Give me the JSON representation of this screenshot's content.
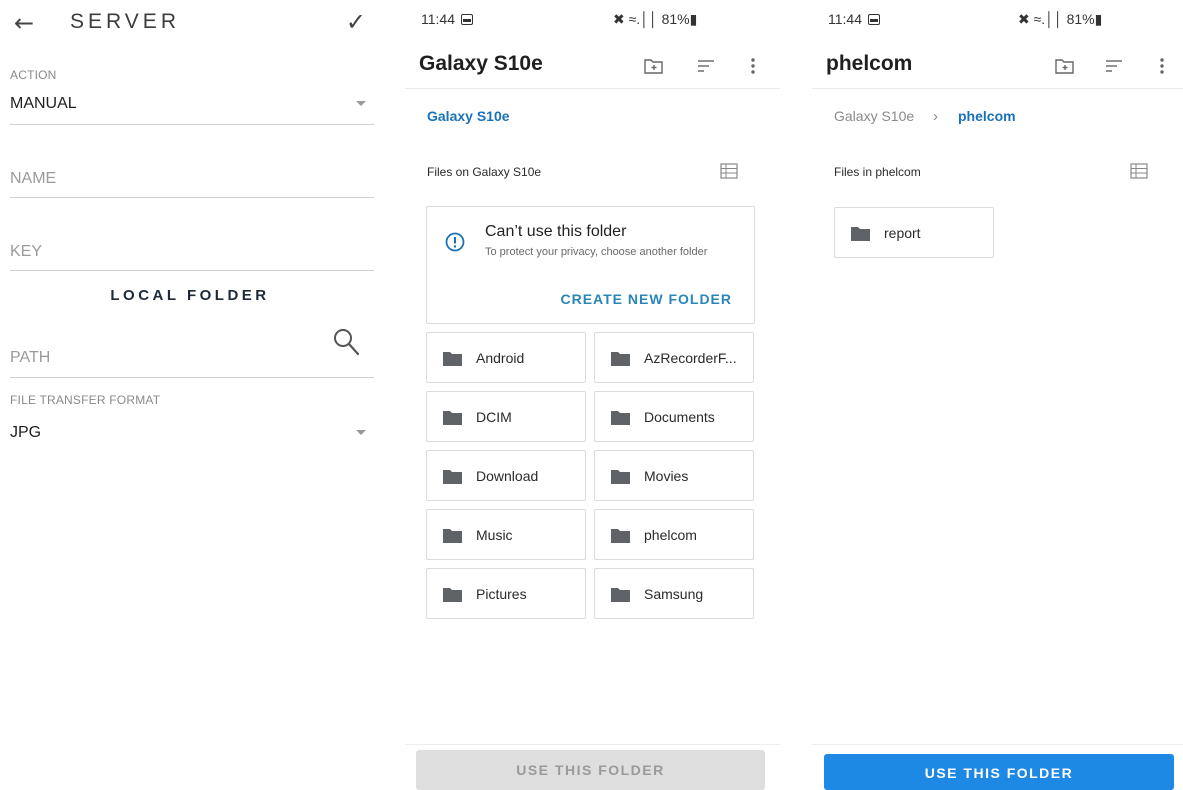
{
  "server_form": {
    "title": "SERVER",
    "back_icon": "arrow-left-icon",
    "confirm_icon": "check-icon",
    "action": {
      "label": "ACTION",
      "value": "MANUAL"
    },
    "name": {
      "placeholder": "NAME"
    },
    "key": {
      "placeholder": "KEY"
    },
    "section_title": "LOCAL FOLDER",
    "path": {
      "placeholder": "PATH",
      "icon": "search-icon"
    },
    "format": {
      "label": "FILE TRANSFER FORMAT",
      "value": "JPG"
    }
  },
  "picker_root": {
    "status": {
      "time": "11:44",
      "right": "✖ ≈.││ 81%▮"
    },
    "title": "Galaxy S10e",
    "icons": [
      "new-folder-icon",
      "sort-icon",
      "more-vert-icon"
    ],
    "breadcrumb": [
      "Galaxy S10e"
    ],
    "files_label": "Files on Galaxy S10e",
    "warning": {
      "title": "Can’t use this folder",
      "text": "To protect your privacy, choose another folder",
      "action": "CREATE NEW FOLDER"
    },
    "folders": [
      "Android",
      "AzRecorderF...",
      "DCIM",
      "Documents",
      "Download",
      "Movies",
      "Music",
      "phelcom",
      "Pictures",
      "Samsung"
    ],
    "button": "USE THIS FOLDER"
  },
  "picker_phelcom": {
    "status": {
      "time": "11:44",
      "right": "✖ ≈.││ 81%▮"
    },
    "title": "phelcom",
    "icons": [
      "new-folder-icon",
      "sort-icon",
      "more-vert-icon"
    ],
    "breadcrumb": [
      "Galaxy S10e",
      "phelcom"
    ],
    "files_label": "Files in phelcom",
    "folders": [
      "report"
    ],
    "button": "USE THIS FOLDER"
  },
  "colors": {
    "link_blue": "#1a73b8",
    "primary_button": "#1e88e5",
    "disabled_button": "#dedede",
    "warning_icon": "#1a73b8"
  }
}
